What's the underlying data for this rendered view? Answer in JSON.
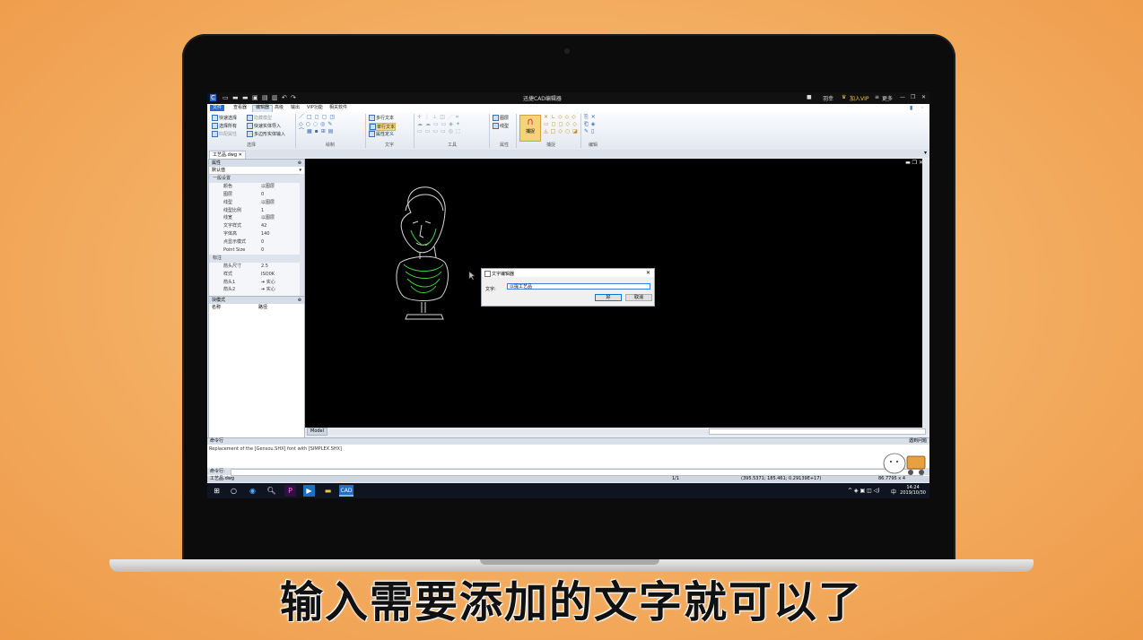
{
  "app": {
    "title": "迅捷CAD编辑器",
    "right": {
      "user": "羽幸",
      "vip": "加入VIP",
      "more": "更多"
    }
  },
  "menubar": [
    "文件",
    "查看器",
    "编辑器",
    "高级",
    "输出",
    "VIP功能",
    "相关软件"
  ],
  "ribbon": {
    "select_group": {
      "label": "选择",
      "items": [
        "快速选择",
        "选择所有",
        "匹配属性",
        "隐藏模型",
        "快速实体导入",
        "多边形实体输入"
      ]
    },
    "draw_group": {
      "label": "绘制"
    },
    "text_group": {
      "label": "文字",
      "items": [
        "多行文本",
        "单行文本",
        "属性定义"
      ]
    },
    "tools_group": {
      "label": "工具"
    },
    "props_group": {
      "label": "属性",
      "items": [
        "图层",
        "线型"
      ]
    },
    "capture_group": {
      "label": "捕捉",
      "button": "捕捉"
    },
    "edit_group": {
      "label": "编辑"
    }
  },
  "document_tab": "工艺品.dwg",
  "properties": {
    "header": "属性",
    "selector": "默认值",
    "rows": [
      {
        "cat": true,
        "k": "一般设置",
        "v": ""
      },
      {
        "k": "颜色",
        "v": "以图层"
      },
      {
        "k": "图层",
        "v": "0"
      },
      {
        "k": "线型",
        "v": "以图层"
      },
      {
        "k": "线型比例",
        "v": "1"
      },
      {
        "k": "线宽",
        "v": "以图层"
      },
      {
        "k": "文字样式",
        "v": "42"
      },
      {
        "k": "字体高",
        "v": "140"
      },
      {
        "k": "点显示模式",
        "v": "0"
      },
      {
        "k": "Point Size",
        "v": "0"
      },
      {
        "cat": true,
        "k": "标注",
        "v": ""
      },
      {
        "k": "箭头尺寸",
        "v": "2.5"
      },
      {
        "k": "样式",
        "v": "ISO0K"
      },
      {
        "k": "箭头1",
        "v": "➔ 实心"
      },
      {
        "k": "箭头2",
        "v": "➔ 实心"
      }
    ]
  },
  "blocks": {
    "header": "块模式",
    "col_name": "名称",
    "col_path": "路径"
  },
  "canvas": {
    "model_tab": "Model"
  },
  "dialog": {
    "title": "文字编辑器",
    "label": "文字:",
    "value": "以提工艺品",
    "ok": "好",
    "cancel": "取消"
  },
  "command": {
    "header": "命令行",
    "log": "Replacement of the [Gensou.SHX] font with [SIMPLEX.SHX]",
    "prompt": "命令行:",
    "right_label": "遇到问题"
  },
  "status": {
    "file": "工艺品.dwg",
    "page": "1/1",
    "coords": "(395.5371; 185.461; 0.29139E+17)",
    "right": "86.7795 x 4"
  },
  "taskbar": {
    "time": "14:24",
    "date": "2019/10/30",
    "lang": "中"
  },
  "subtitle": "输入需要添加的文字就可以了",
  "colors": {
    "accent": "#2a6ad0",
    "drawing": "#d8d8d8",
    "drawing_green": "#3fd43f",
    "background": "#f3ad61"
  }
}
